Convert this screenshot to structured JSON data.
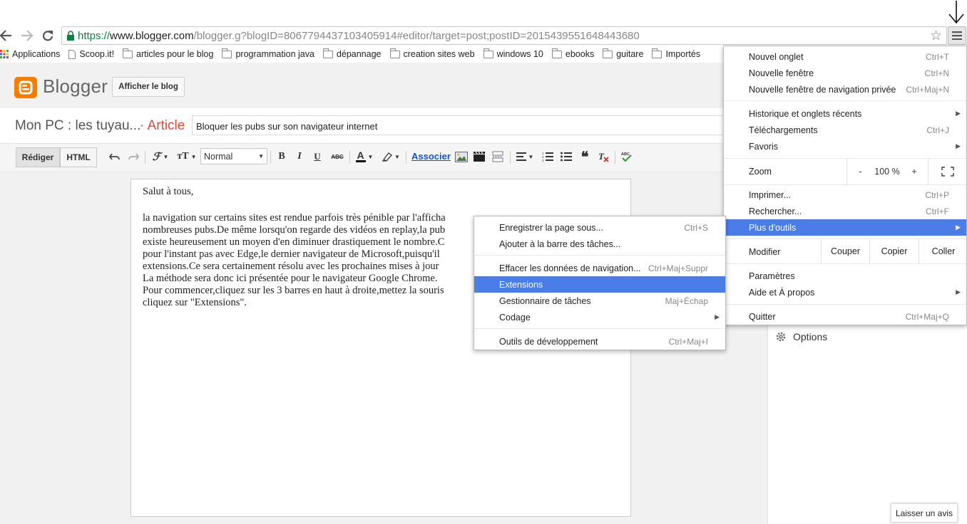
{
  "browser": {
    "url_scheme": "https://",
    "url_host": "www.blogger.com",
    "url_rest": "/blogger.g?blogID=8067794437103405914#editor/target=post;postID=2015439551648443680"
  },
  "bookmarks": [
    {
      "label": "Applications",
      "icon": "apps-grid-icon"
    },
    {
      "label": "Scoop.it!",
      "icon": "page-icon"
    },
    {
      "label": "articles pour le blog",
      "icon": "folder-icon"
    },
    {
      "label": "programmation java",
      "icon": "folder-icon"
    },
    {
      "label": "dépannage",
      "icon": "folder-icon"
    },
    {
      "label": "creation sites web",
      "icon": "folder-icon"
    },
    {
      "label": "windows 10",
      "icon": "folder-icon"
    },
    {
      "label": "ebooks",
      "icon": "folder-icon"
    },
    {
      "label": "guitare",
      "icon": "folder-icon"
    },
    {
      "label": "Importés",
      "icon": "folder-icon"
    }
  ],
  "blogger": {
    "logo_text": "Blogger",
    "view_blog": "Afficher le blog",
    "blog_name": "Mon PC : les tuyau...",
    "article_label": "· Article",
    "post_title": "Bloquer les pubs sur son navigateur internet"
  },
  "toolbar": {
    "compose": "Rédiger",
    "html": "HTML",
    "font_style": "Normal",
    "link": "Associer"
  },
  "editor": {
    "lines": [
      "Salut à tous,",
      "",
      "la navigation sur certains sites est rendue parfois très pénible par l'afficha",
      "nombreuses pubs.De même lorsqu'on regarde des vidéos en replay,la pub",
      "existe heureusement un moyen d'en diminuer drastiquement le nombre.C",
      "pour l'instant pas avec Edge,le dernier navigateur de Microsoft,puisqu'il",
      "extensions.Ce sera certainement résolu avec les prochaines mises à jour",
      "La méthode sera donc ici présentée pour le navigateur Google Chrome.",
      "Pour commencer,cliquez sur les 3 barres en haut à droite,mettez la souris",
      "cliquez sur \"Extensions\"."
    ]
  },
  "sidebar": {
    "options": "Options",
    "feedback": "Laisser un avis"
  },
  "main_menu": {
    "new_tab": {
      "label": "Nouvel onglet",
      "shortcut": "Ctrl+T"
    },
    "new_window": {
      "label": "Nouvelle fenêtre",
      "shortcut": "Ctrl+N"
    },
    "incognito": {
      "label": "Nouvelle fenêtre de navigation privée",
      "shortcut": "Ctrl+Maj+N"
    },
    "history": {
      "label": "Historique et onglets récents"
    },
    "downloads": {
      "label": "Téléchargements",
      "shortcut": "Ctrl+J"
    },
    "bookmarks": {
      "label": "Favoris"
    },
    "zoom": {
      "label": "Zoom",
      "minus": "-",
      "value": "100 %",
      "plus": "+"
    },
    "print": {
      "label": "Imprimer...",
      "shortcut": "Ctrl+P"
    },
    "find": {
      "label": "Rechercher...",
      "shortcut": "Ctrl+F"
    },
    "more_tools": {
      "label": "Plus d'outils"
    },
    "edit": {
      "label": "Modifier",
      "cut": "Couper",
      "copy": "Copier",
      "paste": "Coller"
    },
    "settings": {
      "label": "Paramètres"
    },
    "help": {
      "label": "Aide et À propos"
    },
    "quit": {
      "label": "Quitter",
      "shortcut": "Ctrl+Maj+Q"
    }
  },
  "sub_menu": {
    "save_page": {
      "label": "Enregistrer la page sous...",
      "shortcut": "Ctrl+S"
    },
    "add_taskbar": {
      "label": "Ajouter à la barre des tâches..."
    },
    "clear_data": {
      "label": "Effacer les données de navigation...",
      "shortcut": "Ctrl+Maj+Suppr"
    },
    "extensions": {
      "label": "Extensions"
    },
    "task_manager": {
      "label": "Gestionnaire de tâches",
      "shortcut": "Maj+Échap"
    },
    "encoding": {
      "label": "Codage"
    },
    "dev_tools": {
      "label": "Outils de développement",
      "shortcut": "Ctrl+Maj+I"
    }
  },
  "colors": {
    "highlight": "#4a7de6",
    "blogger_orange": "#f57d00",
    "article_red": "#dd4b39",
    "secure_green": "#0b8043"
  }
}
